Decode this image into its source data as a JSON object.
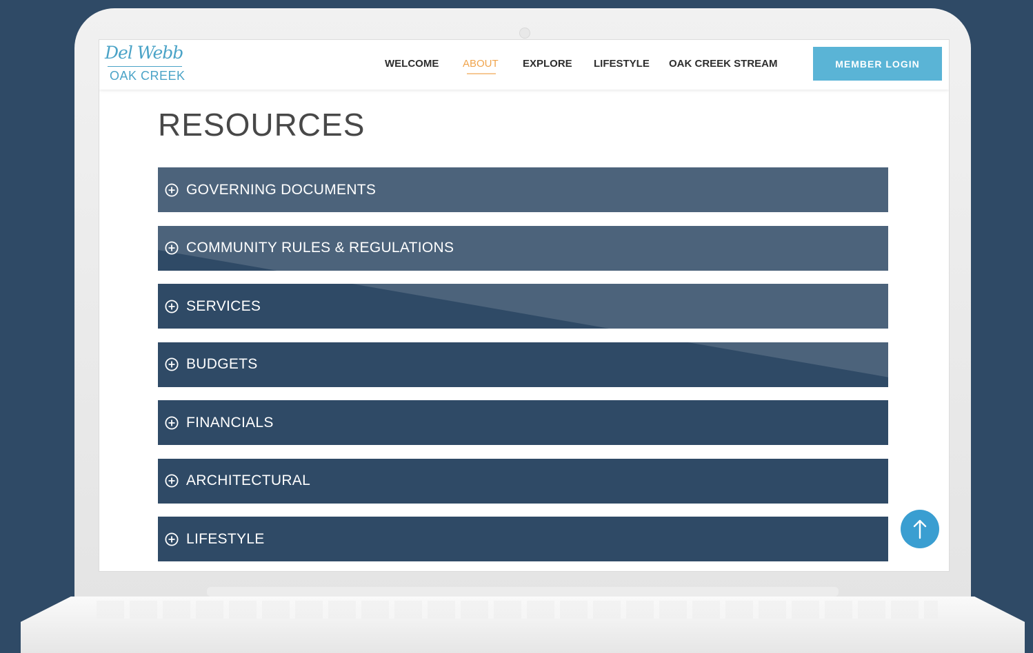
{
  "logo": {
    "script": "Del Webb",
    "name": "OAK CREEK"
  },
  "nav": {
    "items": [
      {
        "label": "WELCOME"
      },
      {
        "label": "ABOUT"
      },
      {
        "label": "EXPLORE"
      },
      {
        "label": "LIFESTYLE"
      },
      {
        "label": "OAK CREEK STREAM"
      }
    ],
    "active": "ABOUT",
    "login_label": "MEMBER LOGIN"
  },
  "page": {
    "title": "RESOURCES"
  },
  "accordion": {
    "items": [
      {
        "label": "GOVERNING DOCUMENTS"
      },
      {
        "label": "COMMUNITY RULES & REGULATIONS"
      },
      {
        "label": "SERVICES"
      },
      {
        "label": "BUDGETS"
      },
      {
        "label": "FINANCIALS"
      },
      {
        "label": "ARCHITECTURAL"
      },
      {
        "label": "LIFESTYLE"
      }
    ]
  },
  "colors": {
    "background": "#2f4a66",
    "accordion": "#2f4a66",
    "accent_orange": "#f0a44c",
    "brand_blue": "#5ab4d6",
    "scroll_top": "#3a9ed1"
  },
  "icons": {
    "accordion": "plus-circle-icon",
    "scroll_top": "arrow-up-icon"
  }
}
